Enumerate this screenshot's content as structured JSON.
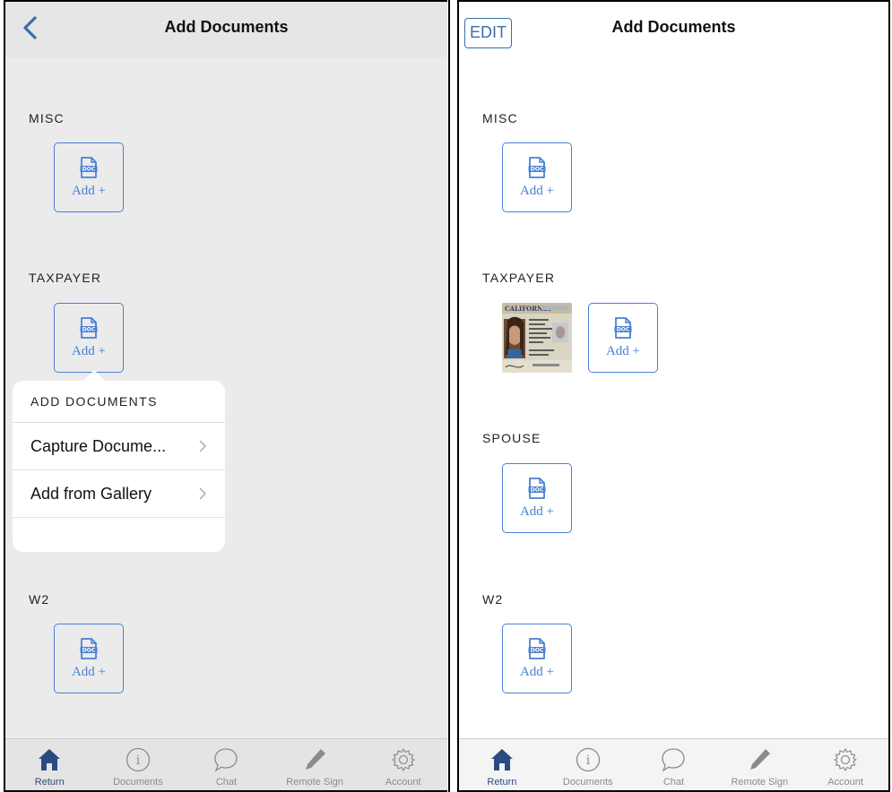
{
  "left": {
    "nav_title": "Add Documents",
    "sections": [
      {
        "label": "MISC",
        "tile_label": "Add +"
      },
      {
        "label": "TAXPAYER",
        "tile_label": "Add +"
      },
      {
        "label": "W2",
        "tile_label": "Add +"
      }
    ],
    "popover": {
      "header": "ADD DOCUMENTS",
      "items": [
        "Capture Docume...",
        "Add from Gallery"
      ]
    }
  },
  "right": {
    "edit_label": "EDIT",
    "nav_title": "Add Documents",
    "sections": [
      {
        "label": "MISC",
        "tile_label": "Add +"
      },
      {
        "label": "TAXPAYER",
        "tile_label": "Add +"
      },
      {
        "label": "SPOUSE",
        "tile_label": "Add +"
      },
      {
        "label": "W2",
        "tile_label": "Add +"
      }
    ]
  },
  "tabs": [
    "Return",
    "Documents",
    "Chat",
    "Remote Sign",
    "Account"
  ],
  "icons": {
    "doc": "doc-icon",
    "back": "chevron-left-icon",
    "tabs": [
      "home-icon",
      "info-icon",
      "chat-bubble-icon",
      "pencil-icon",
      "gear-icon"
    ]
  },
  "colors": {
    "accent": "#4a7fd6",
    "nav_blue": "#3b6ea8",
    "active_tab": "#2b4b80",
    "inactive_tab": "#8b8b8b"
  }
}
